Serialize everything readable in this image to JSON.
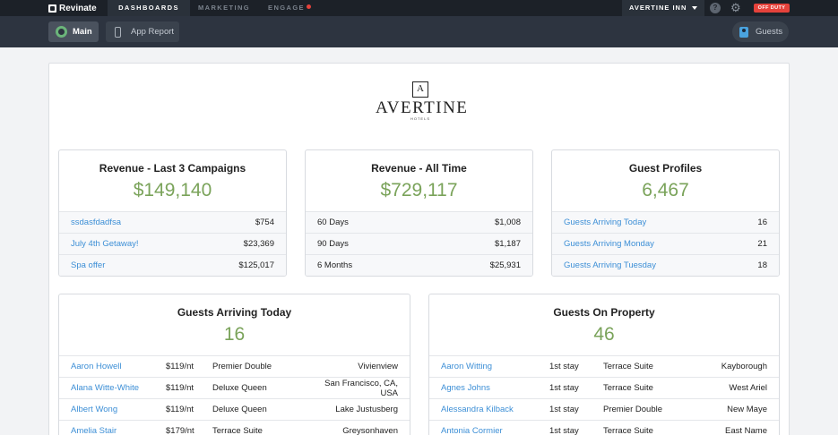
{
  "topbar": {
    "brand": "Revinate",
    "nav": [
      "DASHBOARDS",
      "MARKETING",
      "ENGAGE"
    ],
    "property": "AVERTINE INN",
    "help": "?",
    "status": "OFF DUTY"
  },
  "subnav": {
    "main": "Main",
    "app_report": "App Report",
    "guests": "Guests"
  },
  "logo": {
    "mark": "A",
    "name": "AVERTINE",
    "sub": "HOTELS"
  },
  "cards": {
    "revenue_campaigns": {
      "title": "Revenue - Last 3 Campaigns",
      "value": "$149,140",
      "rows": [
        {
          "label": "ssdasfdadfsa",
          "value": "$754"
        },
        {
          "label": "July 4th Getaway!",
          "value": "$23,369"
        },
        {
          "label": "Spa offer",
          "value": "$125,017"
        }
      ]
    },
    "revenue_all": {
      "title": "Revenue - All Time",
      "value": "$729,117",
      "rows": [
        {
          "label": "60 Days",
          "value": "$1,008"
        },
        {
          "label": "90 Days",
          "value": "$1,187"
        },
        {
          "label": "6 Months",
          "value": "$25,931"
        }
      ]
    },
    "guest_profiles": {
      "title": "Guest Profiles",
      "value": "6,467",
      "rows": [
        {
          "label": "Guests Arriving Today",
          "value": "16"
        },
        {
          "label": "Guests Arriving Monday",
          "value": "21"
        },
        {
          "label": "Guests Arriving Tuesday",
          "value": "18"
        }
      ]
    },
    "arriving_today": {
      "title": "Guests Arriving Today",
      "value": "16",
      "rows": [
        {
          "name": "Aaron Howell",
          "rate": "$119/nt",
          "room": "Premier Double",
          "location": "Vivienview"
        },
        {
          "name": "Alana Witte-White",
          "rate": "$119/nt",
          "room": "Deluxe Queen",
          "location": "San Francisco, CA, USA"
        },
        {
          "name": "Albert Wong",
          "rate": "$119/nt",
          "room": "Deluxe Queen",
          "location": "Lake Justusberg"
        },
        {
          "name": "Amelia Stair",
          "rate": "$179/nt",
          "room": "Terrace Suite",
          "location": "Greysonhaven"
        }
      ]
    },
    "on_property": {
      "title": "Guests On Property",
      "value": "46",
      "rows": [
        {
          "name": "Aaron Witting",
          "stay": "1st stay",
          "room": "Terrace Suite",
          "location": "Kayborough"
        },
        {
          "name": "Agnes Johns",
          "stay": "1st stay",
          "room": "Terrace Suite",
          "location": "West Ariel"
        },
        {
          "name": "Alessandra Kilback",
          "stay": "1st stay",
          "room": "Premier Double",
          "location": "New Maye"
        },
        {
          "name": "Antonia Cormier",
          "stay": "1st stay",
          "room": "Terrace Suite",
          "location": "East Name"
        }
      ]
    }
  }
}
